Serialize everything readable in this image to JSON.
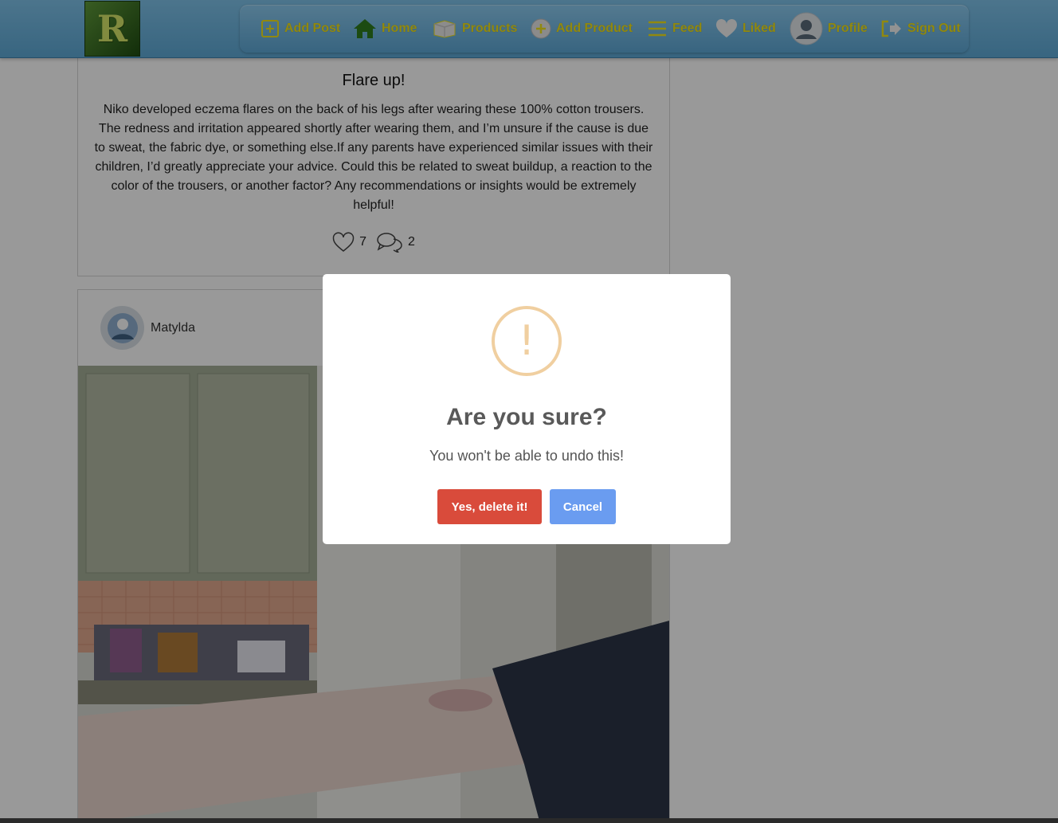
{
  "brand": {
    "logo_letter": "R"
  },
  "nav": {
    "items": [
      {
        "label": "Add Post",
        "icon": "add-square-icon"
      },
      {
        "label": "Home",
        "icon": "home-icon"
      },
      {
        "label": "Products",
        "icon": "box-icon"
      },
      {
        "label": "Add Product",
        "icon": "add-circle-icon"
      },
      {
        "label": "Feed",
        "icon": "menu-lines-icon"
      },
      {
        "label": "Liked",
        "icon": "heart-icon"
      },
      {
        "label": "Profile",
        "icon": "user-avatar-icon"
      },
      {
        "label": "Sign Out",
        "icon": "sign-out-icon"
      }
    ]
  },
  "posts": [
    {
      "title": "Flare up!",
      "body": "Niko developed eczema flares on the back of his legs after wearing these 100% cotton trousers. The redness and irritation appeared shortly after wearing them, and I’m unsure if the cause is due to sweat, the fabric dye, or something else.If any parents have experienced similar issues with their children, I’d greatly appreciate your advice. Could this be related to sweat buildup, a reaction to the color of the trousers, or another factor? Any recommendations or insights would be extremely helpful!",
      "likes": "7",
      "comments": "2"
    },
    {
      "author": "Matylda"
    }
  ],
  "dialog": {
    "icon": "warning-icon",
    "icon_glyph": "!",
    "title": "Are you sure?",
    "text": "You won't be able to undo this!",
    "confirm_label": "Yes, delete it!",
    "cancel_label": "Cancel"
  },
  "colors": {
    "nav_text": "#f2e51a",
    "confirm": "#d94b3b",
    "cancel": "#6a9cf0",
    "warning": "#f0cfa0"
  }
}
